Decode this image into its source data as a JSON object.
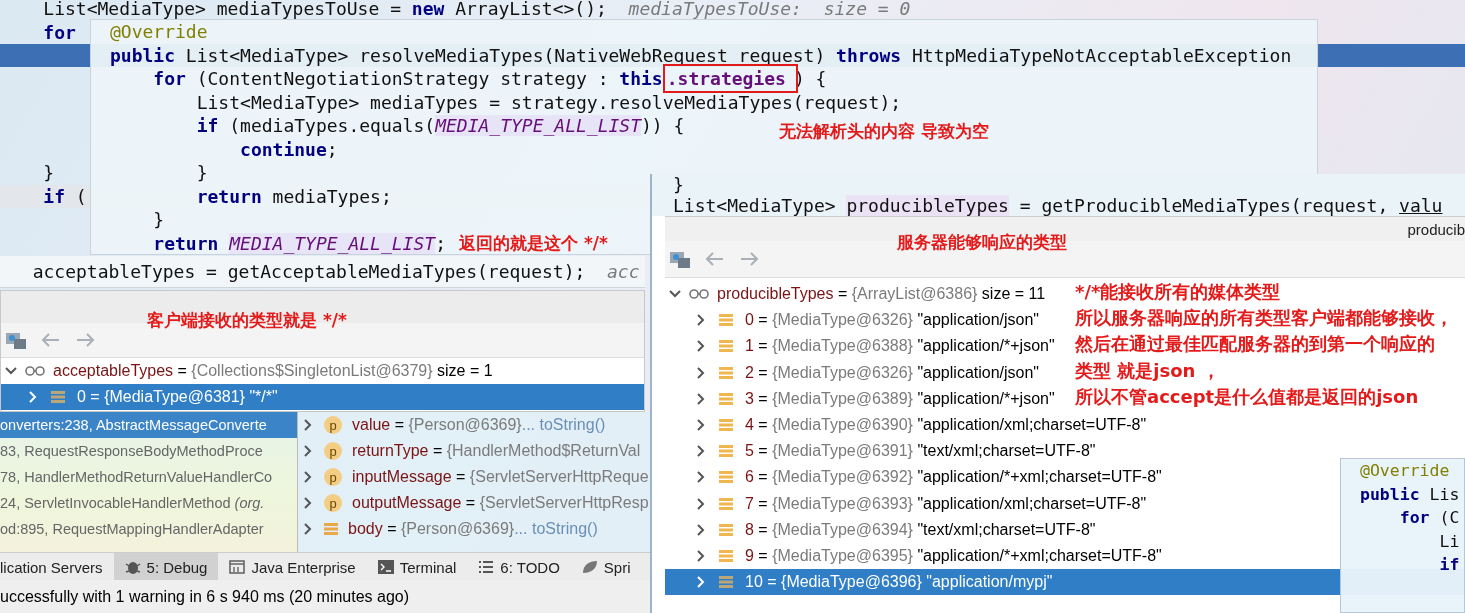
{
  "editor": {
    "top_lines": [
      {
        "tokens": [
          {
            "text": "    List<MediaType> mediaTypesToUse = ",
            "kind": "plain"
          },
          {
            "text": "new",
            "kind": "keyword"
          },
          {
            "text": " ArrayList<>();",
            "kind": "plain"
          },
          {
            "text": "  mediaTypesToUse:  size = 0",
            "kind": "hint"
          }
        ]
      },
      {
        "tokens": [
          {
            "text": "    for",
            "kind": "keyword"
          }
        ]
      }
    ],
    "bottom_lines": [
      {
        "tokens": [
          {
            "text": "    }",
            "kind": "plain"
          }
        ]
      },
      {
        "tokens": [
          {
            "text": "    if",
            "kind": "keyword"
          },
          {
            "text": " (",
            "kind": "plain"
          }
        ]
      }
    ]
  },
  "popup": {
    "lines": [
      {
        "tokens": [
          {
            "text": "@Override",
            "kind": "annotation"
          }
        ]
      },
      {
        "tokens": [
          {
            "text": "public",
            "kind": "keyword"
          },
          {
            "text": " List<MediaType> resolveMediaTypes(NativeWebRequest request) ",
            "kind": "plain"
          },
          {
            "text": "throws",
            "kind": "keyword"
          },
          {
            "text": " HttpMediaTypeNotAcceptableException",
            "kind": "plain"
          }
        ]
      },
      {
        "tokens": [
          {
            "text": "    for",
            "kind": "keyword"
          },
          {
            "text": " (ContentNegotiationStrategy strategy : ",
            "kind": "plain"
          },
          {
            "text": "this",
            "kind": "keyword"
          },
          {
            "text": ".strategies",
            "kind": "field",
            "boxed": true
          },
          {
            "text": ") {",
            "kind": "plain"
          }
        ]
      },
      {
        "tokens": [
          {
            "text": "        List<MediaType> mediaTypes = strategy.resolveMediaTypes(request);",
            "kind": "plain"
          }
        ]
      },
      {
        "tokens": [
          {
            "text": "        if",
            "kind": "keyword"
          },
          {
            "text": " (mediaTypes.equals(",
            "kind": "plain"
          },
          {
            "text": "MEDIA_TYPE_ALL_LIST",
            "kind": "constant"
          },
          {
            "text": ")) {",
            "kind": "plain"
          }
        ]
      },
      {
        "tokens": [
          {
            "text": "            continue",
            "kind": "keyword"
          },
          {
            "text": ";",
            "kind": "plain"
          }
        ]
      },
      {
        "tokens": [
          {
            "text": "        }",
            "kind": "plain"
          }
        ]
      },
      {
        "tokens": [
          {
            "text": "        return",
            "kind": "keyword"
          },
          {
            "text": " mediaTypes;",
            "kind": "plain"
          }
        ]
      },
      {
        "tokens": [
          {
            "text": "    }",
            "kind": "plain"
          }
        ]
      },
      {
        "tokens": [
          {
            "text": "    return ",
            "kind": "keyword"
          },
          {
            "text": "MEDIA_TYPE_ALL_LIST",
            "kind": "constant"
          },
          {
            "text": ";",
            "kind": "plain"
          }
        ]
      }
    ],
    "notes": [
      {
        "text": "无法解析头的内容 导致为空",
        "kind": "middle"
      },
      {
        "text": "返回的就是这个 */*",
        "kind": "bottom"
      }
    ]
  },
  "accept_line": {
    "tokens": [
      {
        "text": "  acceptableTypes = getAcceptableMediaTypes(request);",
        "kind": "plain"
      },
      {
        "text": "  acc",
        "kind": "hint"
      }
    ]
  },
  "left_debug": {
    "note": "客户端接收的类型就是 */*",
    "tree": [
      {
        "kind": "watch",
        "name": "acceptableTypes",
        "sign": "=",
        "ref": "{Collections$SingletonList@6379}",
        "value": "size = 1",
        "expanded": true,
        "selected": false,
        "children": [
          {
            "kind": "field",
            "name": "0",
            "sign": "=",
            "ref": "{MediaType@6381}",
            "value": "\"*/*\"",
            "expanded": false,
            "selected": true
          }
        ]
      }
    ]
  },
  "frames": [
    {
      "text": "onverters:238, AbstractMessageConverte",
      "selected": true
    },
    {
      "text": "83, RequestResponseBodyMethodProce",
      "selected": false
    },
    {
      "text": "78, HandlerMethodReturnValueHandlerCo",
      "selected": false
    },
    {
      "text": "24, ServletInvocableHandlerMethod *(org.*",
      "selected": false
    },
    {
      "text": "od:895, RequestMappingHandlerAdapter",
      "selected": false
    }
  ],
  "variables": [
    {
      "kind": "param",
      "badge": "p",
      "name": "value",
      "sign": "=",
      "ref": "{Person@6369}",
      "action": "... toString()",
      "expanded": false
    },
    {
      "kind": "param",
      "badge": "p",
      "name": "returnType",
      "sign": "=",
      "ref": "{HandlerMethod$ReturnVal",
      "expanded": false
    },
    {
      "kind": "param",
      "badge": "p",
      "name": "inputMessage",
      "sign": "=",
      "ref": "{ServletServerHttpReque",
      "expanded": false
    },
    {
      "kind": "param",
      "badge": "p",
      "name": "outputMessage",
      "sign": "=",
      "ref": "{ServletServerHttpResp",
      "expanded": false
    },
    {
      "kind": "field",
      "name": "body",
      "sign": "=",
      "ref": "{Person@6369}",
      "action": "... toString()",
      "expanded": false
    }
  ],
  "tool_tabs": [
    {
      "label": "lication Servers",
      "selected": false
    },
    {
      "label": "5: Debug",
      "kind": "bug",
      "selected": true
    },
    {
      "label": "Java Enterprise",
      "kind": "enterprise",
      "selected": false
    },
    {
      "label": "Terminal",
      "kind": "terminal",
      "selected": false
    },
    {
      "label": "6: TODO",
      "kind": "list",
      "selected": false
    },
    {
      "label": "Spri",
      "kind": "leaf",
      "selected": false
    }
  ],
  "status_bar": "uccessfully with 1 warning in 6 s 940 ms (20 minutes ago)",
  "right_debug": {
    "code": [
      {
        "tokens": [
          {
            "text": "}",
            "kind": "plain"
          }
        ]
      },
      {
        "tokens": [
          {
            "text": "List<MediaType> ",
            "kind": "plain"
          },
          {
            "text": "producibleTypes",
            "kind": "variable"
          },
          {
            "text": " = getProducibleMediaTypes(request, ",
            "kind": "plain"
          },
          {
            "text": "valu",
            "kind": "underlined"
          }
        ]
      }
    ],
    "header": "producib",
    "note": "服务器能够响应的类型",
    "side_note": [
      "*/*能接收所有的媒体类型",
      "所以服务器响应的所有类型客户端都能够接收，",
      "然后在通过最佳匹配服务器的到第一个响应的",
      "类型 就是json ，",
      "所以不管accept是什么值都是返回的json"
    ],
    "tree": [
      {
        "kind": "watch",
        "name": "producibleTypes",
        "sign": "=",
        "ref": "{ArrayList@6386}",
        "value": "size = 11",
        "expanded": true,
        "selected": false,
        "children": [
          {
            "kind": "field",
            "name": "0",
            "sign": "=",
            "ref": "{MediaType@6326}",
            "value": "\"application/json\"",
            "expanded": false,
            "selected": false
          },
          {
            "kind": "field",
            "name": "1",
            "sign": "=",
            "ref": "{MediaType@6388}",
            "value": "\"application/*+json\"",
            "expanded": false,
            "selected": false
          },
          {
            "kind": "field",
            "name": "2",
            "sign": "=",
            "ref": "{MediaType@6326}",
            "value": "\"application/json\"",
            "expanded": false,
            "selected": false
          },
          {
            "kind": "field",
            "name": "3",
            "sign": "=",
            "ref": "{MediaType@6389}",
            "value": "\"application/*+json\"",
            "expanded": false,
            "selected": false
          },
          {
            "kind": "field",
            "name": "4",
            "sign": "=",
            "ref": "{MediaType@6390}",
            "value": "\"application/xml;charset=UTF-8\"",
            "expanded": false,
            "selected": false
          },
          {
            "kind": "field",
            "name": "5",
            "sign": "=",
            "ref": "{MediaType@6391}",
            "value": "\"text/xml;charset=UTF-8\"",
            "expanded": false,
            "selected": false
          },
          {
            "kind": "field",
            "name": "6",
            "sign": "=",
            "ref": "{MediaType@6392}",
            "value": "\"application/*+xml;charset=UTF-8\"",
            "expanded": false,
            "selected": false
          },
          {
            "kind": "field",
            "name": "7",
            "sign": "=",
            "ref": "{MediaType@6393}",
            "value": "\"application/xml;charset=UTF-8\"",
            "expanded": false,
            "selected": false
          },
          {
            "kind": "field",
            "name": "8",
            "sign": "=",
            "ref": "{MediaType@6394}",
            "value": "\"text/xml;charset=UTF-8\"",
            "expanded": false,
            "selected": false
          },
          {
            "kind": "field",
            "name": "9",
            "sign": "=",
            "ref": "{MediaType@6395}",
            "value": "\"application/*+xml;charset=UTF-8\"",
            "expanded": false,
            "selected": false
          },
          {
            "kind": "field",
            "name": "10",
            "sign": "=",
            "ref": "{MediaType@6396}",
            "value": "\"application/mypj\"",
            "expanded": false,
            "selected": true
          }
        ]
      }
    ]
  },
  "small_popup": {
    "lines": [
      {
        "tokens": [
          {
            "text": "@Override",
            "kind": "annotation"
          }
        ]
      },
      {
        "tokens": [
          {
            "text": "public",
            "kind": "keyword"
          },
          {
            "text": " Lis",
            "kind": "plain"
          }
        ]
      },
      {
        "tokens": [
          {
            "text": "    for",
            "kind": "keyword"
          },
          {
            "text": " (C",
            "kind": "plain"
          }
        ]
      },
      {
        "tokens": [
          {
            "text": "        Li",
            "kind": "plain"
          }
        ]
      },
      {
        "tokens": [
          {
            "text": "        if",
            "kind": "keyword"
          }
        ]
      }
    ]
  }
}
